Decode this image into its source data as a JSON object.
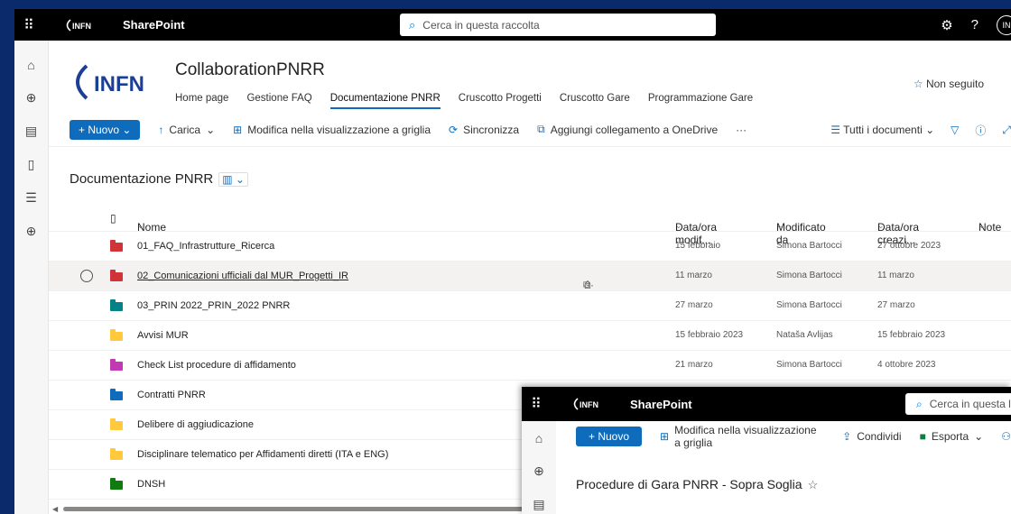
{
  "suitebar": {
    "app_name": "SharePoint",
    "search_placeholder": "Cerca in questa raccolta",
    "avatar_initials": "IN",
    "logo_text": "INFN"
  },
  "site": {
    "logo_text": "INFN",
    "title": "CollaborationPNRR",
    "nav": [
      "Home page",
      "Gestione FAQ",
      "Documentazione PNRR",
      "Cruscotto Progetti",
      "Cruscotto Gare",
      "Programmazione Gare"
    ],
    "active_nav": "Documentazione PNRR",
    "follow_label": "Non seguito"
  },
  "commands": {
    "new_label": "Nuovo",
    "upload_label": "Carica",
    "grid_edit_label": "Modifica nella visualizzazione a griglia",
    "sync_label": "Sincronizza",
    "onedrive_label": "Aggiungi collegamento a OneDrive",
    "more_label": "···",
    "view_label": "Tutti i documenti"
  },
  "library": {
    "title": "Documentazione PNRR",
    "columns": {
      "name": "Nome",
      "modified": "Data/ora modif...",
      "modified_by": "Modificato da",
      "created": "Data/ora creazi...",
      "notes": "Note"
    },
    "rows": [
      {
        "name": "01_FAQ_Infrastrutture_Ricerca",
        "modified": "15 febbraio",
        "modified_by": "Simona Bartocci",
        "created": "27 ottobre 2023",
        "color": "#d13438"
      },
      {
        "name": "02_Comunicazioni ufficiali dal MUR_Progetti_IR",
        "modified": "11 marzo",
        "modified_by": "Simona Bartocci",
        "created": "11 marzo",
        "color": "#d13438"
      },
      {
        "name": "03_PRIN 2022_PRIN_2022 PNRR",
        "modified": "27 marzo",
        "modified_by": "Simona Bartocci",
        "created": "27 marzo",
        "color": "#038387"
      },
      {
        "name": "Avvisi MUR",
        "modified": "15 febbraio 2023",
        "modified_by": "Nataša Avlijas",
        "created": "15 febbraio 2023",
        "color": "#ffc83d"
      },
      {
        "name": "Check List procedure di affidamento",
        "modified": "21 marzo",
        "modified_by": "Simona Bartocci",
        "created": "4 ottobre 2023",
        "color": "#c239b3"
      },
      {
        "name": "Contratti PNRR",
        "modified": "",
        "modified_by": "",
        "created": "",
        "color": "#0f6cbd"
      },
      {
        "name": "Delibere di aggiudicazione",
        "modified": "",
        "modified_by": "",
        "created": "",
        "color": "#ffc83d"
      },
      {
        "name": "Disciplinare telematico per Affidamenti diretti (ITA e ENG)",
        "modified": "",
        "modified_by": "",
        "created": "",
        "color": "#ffc83d"
      },
      {
        "name": "DNSH",
        "modified": "",
        "modified_by": "",
        "created": "",
        "color": "#107c10"
      }
    ]
  },
  "overlay": {
    "app_name": "SharePoint",
    "logo_text": "INFN",
    "search_placeholder": "Cerca in questa lis",
    "new_label": "Nuovo",
    "grid_edit_label": "Modifica nella visualizzazione a griglia",
    "share_label": "Condividi",
    "export_label": "Esporta",
    "title": "Procedure di Gara PNRR - Sopra Soglia"
  }
}
